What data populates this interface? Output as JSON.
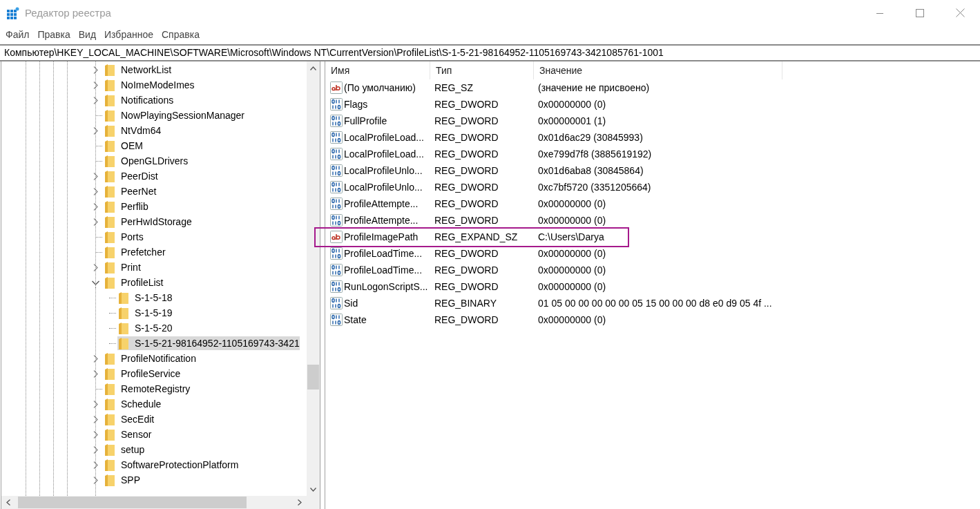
{
  "window": {
    "title": "Редактор реестра"
  },
  "menu": [
    "Файл",
    "Правка",
    "Вид",
    "Избранное",
    "Справка"
  ],
  "address": "Компьютер\\HKEY_LOCAL_MACHINE\\SOFTWARE\\Microsoft\\Windows NT\\CurrentVersion\\ProfileList\\S-1-5-21-98164952-1105169743-3421085761-1001",
  "tree": [
    {
      "name": "NetworkList",
      "has_children": true,
      "expanded": false,
      "selected": false
    },
    {
      "name": "NoImeModeImes",
      "has_children": true,
      "expanded": false,
      "selected": false
    },
    {
      "name": "Notifications",
      "has_children": true,
      "expanded": false,
      "selected": false
    },
    {
      "name": "NowPlayingSessionManager",
      "has_children": false,
      "selected": false
    },
    {
      "name": "NtVdm64",
      "has_children": true,
      "expanded": false,
      "selected": false
    },
    {
      "name": "OEM",
      "has_children": false,
      "selected": false
    },
    {
      "name": "OpenGLDrivers",
      "has_children": false,
      "selected": false
    },
    {
      "name": "PeerDist",
      "has_children": true,
      "expanded": false,
      "selected": false
    },
    {
      "name": "PeerNet",
      "has_children": true,
      "expanded": false,
      "selected": false
    },
    {
      "name": "Perflib",
      "has_children": true,
      "expanded": false,
      "selected": false
    },
    {
      "name": "PerHwIdStorage",
      "has_children": true,
      "expanded": false,
      "selected": false
    },
    {
      "name": "Ports",
      "has_children": false,
      "selected": false
    },
    {
      "name": "Prefetcher",
      "has_children": false,
      "selected": false
    },
    {
      "name": "Print",
      "has_children": true,
      "expanded": false,
      "selected": false
    },
    {
      "name": "ProfileList",
      "has_children": true,
      "expanded": true,
      "selected": false,
      "children": [
        {
          "name": "S-1-5-18",
          "has_children": false,
          "selected": false
        },
        {
          "name": "S-1-5-19",
          "has_children": false,
          "selected": false
        },
        {
          "name": "S-1-5-20",
          "has_children": false,
          "selected": false
        },
        {
          "name": "S-1-5-21-98164952-1105169743-3421",
          "has_children": false,
          "selected": true
        }
      ]
    },
    {
      "name": "ProfileNotification",
      "has_children": true,
      "expanded": false,
      "selected": false
    },
    {
      "name": "ProfileService",
      "has_children": true,
      "expanded": false,
      "selected": false
    },
    {
      "name": "RemoteRegistry",
      "has_children": false,
      "selected": false
    },
    {
      "name": "Schedule",
      "has_children": true,
      "expanded": false,
      "selected": false
    },
    {
      "name": "SecEdit",
      "has_children": true,
      "expanded": false,
      "selected": false
    },
    {
      "name": "Sensor",
      "has_children": true,
      "expanded": false,
      "selected": false
    },
    {
      "name": "setup",
      "has_children": true,
      "expanded": false,
      "selected": false
    },
    {
      "name": "SoftwareProtectionPlatform",
      "has_children": true,
      "expanded": false,
      "selected": false
    },
    {
      "name": "SPP",
      "has_children": true,
      "expanded": false,
      "selected": false
    }
  ],
  "list": {
    "columns": [
      "Имя",
      "Тип",
      "Значение"
    ],
    "rows": [
      {
        "name": "(По умолчанию)",
        "type": "REG_SZ",
        "value": "(значение не присвоено)",
        "kind": "string",
        "highlighted": false
      },
      {
        "name": "Flags",
        "type": "REG_DWORD",
        "value": "0x00000000 (0)",
        "kind": "binary",
        "highlighted": false
      },
      {
        "name": "FullProfile",
        "type": "REG_DWORD",
        "value": "0x00000001 (1)",
        "kind": "binary",
        "highlighted": false
      },
      {
        "name": "LocalProfileLoad...",
        "type": "REG_DWORD",
        "value": "0x01d6ac29 (30845993)",
        "kind": "binary",
        "highlighted": false
      },
      {
        "name": "LocalProfileLoad...",
        "type": "REG_DWORD",
        "value": "0xe799d7f8 (3885619192)",
        "kind": "binary",
        "highlighted": false
      },
      {
        "name": "LocalProfileUnlo...",
        "type": "REG_DWORD",
        "value": "0x01d6aba8 (30845864)",
        "kind": "binary",
        "highlighted": false
      },
      {
        "name": "LocalProfileUnlo...",
        "type": "REG_DWORD",
        "value": "0xc7bf5720 (3351205664)",
        "kind": "binary",
        "highlighted": false
      },
      {
        "name": "ProfileAttempte...",
        "type": "REG_DWORD",
        "value": "0x00000000 (0)",
        "kind": "binary",
        "highlighted": false
      },
      {
        "name": "ProfileAttempte...",
        "type": "REG_DWORD",
        "value": "0x00000000 (0)",
        "kind": "binary",
        "highlighted": false
      },
      {
        "name": "ProfileImagePath",
        "type": "REG_EXPAND_SZ",
        "value": "C:\\Users\\Darya",
        "kind": "string",
        "highlighted": true
      },
      {
        "name": "ProfileLoadTime...",
        "type": "REG_DWORD",
        "value": "0x00000000 (0)",
        "kind": "binary",
        "highlighted": false
      },
      {
        "name": "ProfileLoadTime...",
        "type": "REG_DWORD",
        "value": "0x00000000 (0)",
        "kind": "binary",
        "highlighted": false
      },
      {
        "name": "RunLogonScriptS...",
        "type": "REG_DWORD",
        "value": "0x00000000 (0)",
        "kind": "binary",
        "highlighted": false
      },
      {
        "name": "Sid",
        "type": "REG_BINARY",
        "value": "01 05 00 00 00 00 00 05 15 00 00 00 d8 e0 d9 05 4f ...",
        "kind": "binary",
        "highlighted": false
      },
      {
        "name": "State",
        "type": "REG_DWORD",
        "value": "0x00000000 (0)",
        "kind": "binary",
        "highlighted": false
      }
    ]
  }
}
